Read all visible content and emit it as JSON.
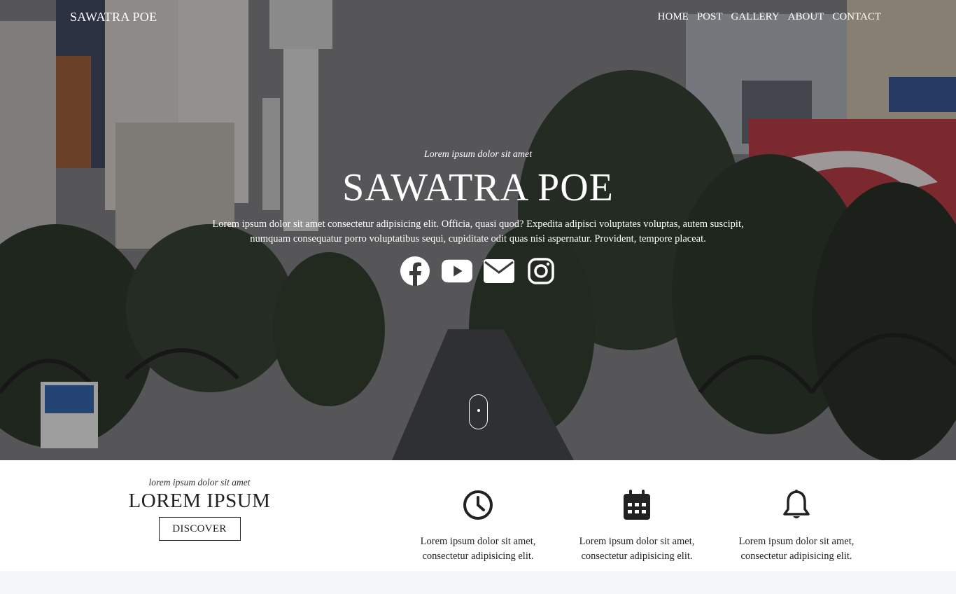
{
  "brand": "SAWATRA POE",
  "nav": [
    "HOME",
    "POST",
    "GALLERY",
    "ABOUT",
    "CONTACT"
  ],
  "hero": {
    "tagline": "Lorem ipsum dolor sit amet",
    "title": "SAWATRA POE",
    "description": "Lorem ipsum dolor sit amet consectetur adipisicing elit. Officia, quasi quod? Expedita adipisci voluptates voluptas, autem suscipit, numquam consequatur porro voluptatibus sequi, cupiditate odit quas nisi aspernatur. Provident, tempore placeat.",
    "social_icons": [
      "facebook-icon",
      "youtube-icon",
      "envelope-icon",
      "instagram-icon"
    ]
  },
  "lead": {
    "small": "lorem ipsum dolor sit amet",
    "big": "LOREM IPSUM",
    "button": "DISCOVER"
  },
  "features": [
    {
      "icon": "clock-icon",
      "text": "Lorem ipsum dolor sit amet, consectetur adipisicing elit."
    },
    {
      "icon": "calendar-icon",
      "text": "Lorem ipsum dolor sit amet, consectetur adipisicing elit."
    },
    {
      "icon": "bell-icon",
      "text": "Lorem ipsum dolor sit amet, consectetur adipisicing elit."
    }
  ],
  "colors": {
    "text_dark": "#222222",
    "hero_overlay": "#141418",
    "footer_bg": "#f6f7f9"
  }
}
